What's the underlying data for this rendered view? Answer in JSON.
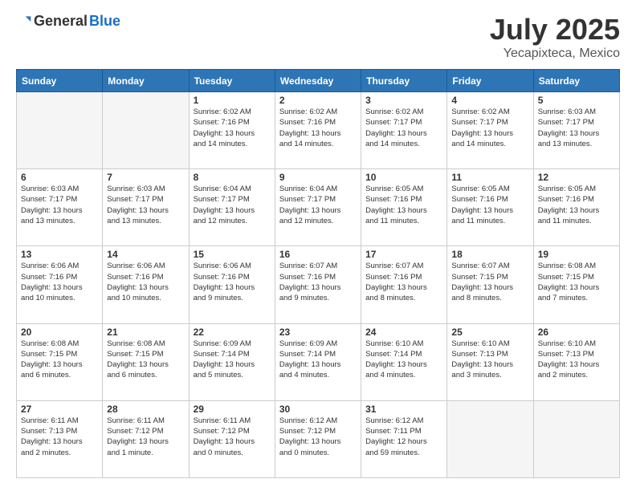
{
  "logo": {
    "general": "General",
    "blue": "Blue"
  },
  "title": "July 2025",
  "subtitle": "Yecapixteca, Mexico",
  "headers": [
    "Sunday",
    "Monday",
    "Tuesday",
    "Wednesday",
    "Thursday",
    "Friday",
    "Saturday"
  ],
  "weeks": [
    [
      {
        "day": "",
        "info": ""
      },
      {
        "day": "",
        "info": ""
      },
      {
        "day": "1",
        "info": "Sunrise: 6:02 AM\nSunset: 7:16 PM\nDaylight: 13 hours\nand 14 minutes."
      },
      {
        "day": "2",
        "info": "Sunrise: 6:02 AM\nSunset: 7:16 PM\nDaylight: 13 hours\nand 14 minutes."
      },
      {
        "day": "3",
        "info": "Sunrise: 6:02 AM\nSunset: 7:17 PM\nDaylight: 13 hours\nand 14 minutes."
      },
      {
        "day": "4",
        "info": "Sunrise: 6:02 AM\nSunset: 7:17 PM\nDaylight: 13 hours\nand 14 minutes."
      },
      {
        "day": "5",
        "info": "Sunrise: 6:03 AM\nSunset: 7:17 PM\nDaylight: 13 hours\nand 13 minutes."
      }
    ],
    [
      {
        "day": "6",
        "info": "Sunrise: 6:03 AM\nSunset: 7:17 PM\nDaylight: 13 hours\nand 13 minutes."
      },
      {
        "day": "7",
        "info": "Sunrise: 6:03 AM\nSunset: 7:17 PM\nDaylight: 13 hours\nand 13 minutes."
      },
      {
        "day": "8",
        "info": "Sunrise: 6:04 AM\nSunset: 7:17 PM\nDaylight: 13 hours\nand 12 minutes."
      },
      {
        "day": "9",
        "info": "Sunrise: 6:04 AM\nSunset: 7:17 PM\nDaylight: 13 hours\nand 12 minutes."
      },
      {
        "day": "10",
        "info": "Sunrise: 6:05 AM\nSunset: 7:16 PM\nDaylight: 13 hours\nand 11 minutes."
      },
      {
        "day": "11",
        "info": "Sunrise: 6:05 AM\nSunset: 7:16 PM\nDaylight: 13 hours\nand 11 minutes."
      },
      {
        "day": "12",
        "info": "Sunrise: 6:05 AM\nSunset: 7:16 PM\nDaylight: 13 hours\nand 11 minutes."
      }
    ],
    [
      {
        "day": "13",
        "info": "Sunrise: 6:06 AM\nSunset: 7:16 PM\nDaylight: 13 hours\nand 10 minutes."
      },
      {
        "day": "14",
        "info": "Sunrise: 6:06 AM\nSunset: 7:16 PM\nDaylight: 13 hours\nand 10 minutes."
      },
      {
        "day": "15",
        "info": "Sunrise: 6:06 AM\nSunset: 7:16 PM\nDaylight: 13 hours\nand 9 minutes."
      },
      {
        "day": "16",
        "info": "Sunrise: 6:07 AM\nSunset: 7:16 PM\nDaylight: 13 hours\nand 9 minutes."
      },
      {
        "day": "17",
        "info": "Sunrise: 6:07 AM\nSunset: 7:16 PM\nDaylight: 13 hours\nand 8 minutes."
      },
      {
        "day": "18",
        "info": "Sunrise: 6:07 AM\nSunset: 7:15 PM\nDaylight: 13 hours\nand 8 minutes."
      },
      {
        "day": "19",
        "info": "Sunrise: 6:08 AM\nSunset: 7:15 PM\nDaylight: 13 hours\nand 7 minutes."
      }
    ],
    [
      {
        "day": "20",
        "info": "Sunrise: 6:08 AM\nSunset: 7:15 PM\nDaylight: 13 hours\nand 6 minutes."
      },
      {
        "day": "21",
        "info": "Sunrise: 6:08 AM\nSunset: 7:15 PM\nDaylight: 13 hours\nand 6 minutes."
      },
      {
        "day": "22",
        "info": "Sunrise: 6:09 AM\nSunset: 7:14 PM\nDaylight: 13 hours\nand 5 minutes."
      },
      {
        "day": "23",
        "info": "Sunrise: 6:09 AM\nSunset: 7:14 PM\nDaylight: 13 hours\nand 4 minutes."
      },
      {
        "day": "24",
        "info": "Sunrise: 6:10 AM\nSunset: 7:14 PM\nDaylight: 13 hours\nand 4 minutes."
      },
      {
        "day": "25",
        "info": "Sunrise: 6:10 AM\nSunset: 7:13 PM\nDaylight: 13 hours\nand 3 minutes."
      },
      {
        "day": "26",
        "info": "Sunrise: 6:10 AM\nSunset: 7:13 PM\nDaylight: 13 hours\nand 2 minutes."
      }
    ],
    [
      {
        "day": "27",
        "info": "Sunrise: 6:11 AM\nSunset: 7:13 PM\nDaylight: 13 hours\nand 2 minutes."
      },
      {
        "day": "28",
        "info": "Sunrise: 6:11 AM\nSunset: 7:12 PM\nDaylight: 13 hours\nand 1 minute."
      },
      {
        "day": "29",
        "info": "Sunrise: 6:11 AM\nSunset: 7:12 PM\nDaylight: 13 hours\nand 0 minutes."
      },
      {
        "day": "30",
        "info": "Sunrise: 6:12 AM\nSunset: 7:12 PM\nDaylight: 13 hours\nand 0 minutes."
      },
      {
        "day": "31",
        "info": "Sunrise: 6:12 AM\nSunset: 7:11 PM\nDaylight: 12 hours\nand 59 minutes."
      },
      {
        "day": "",
        "info": ""
      },
      {
        "day": "",
        "info": ""
      }
    ]
  ]
}
